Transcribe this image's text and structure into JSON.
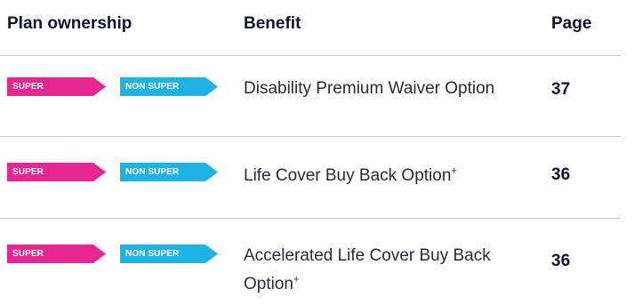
{
  "headers": {
    "plan_ownership": "Plan ownership",
    "benefit": "Benefit",
    "page": "Page"
  },
  "tags": {
    "super": "SUPER",
    "non_super": "NON SUPER"
  },
  "colors": {
    "super_tag": "#e8268f",
    "non_super_tag": "#1fb3e5",
    "divider": "#c9c9d1"
  },
  "rows": [
    {
      "benefit": "Disability Premium Waiver Option",
      "benefit_suffix": "",
      "page": "37"
    },
    {
      "benefit": "Life Cover Buy Back Option",
      "benefit_suffix": "+",
      "page": "36"
    },
    {
      "benefit": "Accelerated Life Cover Buy Back Option",
      "benefit_suffix": "+",
      "page": "36"
    }
  ]
}
